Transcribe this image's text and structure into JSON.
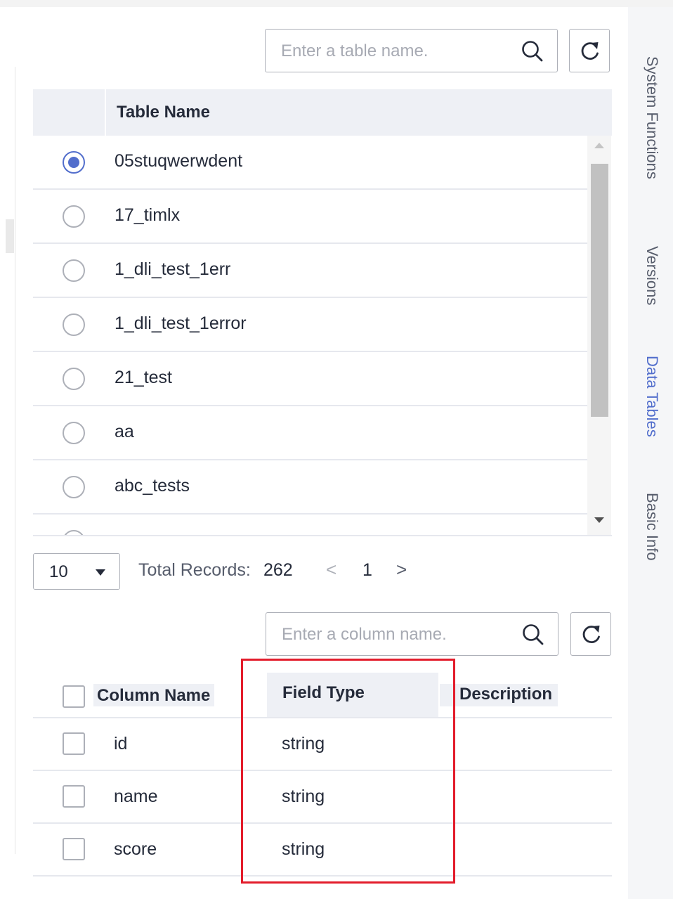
{
  "table_search": {
    "placeholder": "Enter a table name."
  },
  "table_list": {
    "header": "Table Name",
    "rows": [
      {
        "name": "05stuqwerwdent",
        "selected": true
      },
      {
        "name": "17_timlx",
        "selected": false
      },
      {
        "name": "1_dli_test_1err",
        "selected": false
      },
      {
        "name": "1_dli_test_1error",
        "selected": false
      },
      {
        "name": "21_test",
        "selected": false
      },
      {
        "name": "aa",
        "selected": false
      },
      {
        "name": "abc_tests",
        "selected": false
      }
    ]
  },
  "pagination": {
    "page_size": "10",
    "total_label": "Total Records:",
    "total": "262",
    "prev": "<",
    "current_page": "1",
    "next": ">"
  },
  "column_search": {
    "placeholder": "Enter a column name."
  },
  "column_table": {
    "headers": {
      "name": "Column Name",
      "type": "Field Type",
      "description": "Description"
    },
    "rows": [
      {
        "name": "id",
        "type": "string",
        "description": ""
      },
      {
        "name": "name",
        "type": "string",
        "description": ""
      },
      {
        "name": "score",
        "type": "string",
        "description": ""
      }
    ]
  },
  "side_tabs": [
    {
      "label": "System Functions",
      "active": false
    },
    {
      "label": "Versions",
      "active": false
    },
    {
      "label": "Data Tables",
      "active": true
    },
    {
      "label": "Basic Info",
      "active": false
    }
  ],
  "colors": {
    "accent": "#526ecc",
    "highlight": "#e31c2b"
  },
  "icons": {
    "search": "search-icon",
    "refresh": "refresh-icon"
  }
}
